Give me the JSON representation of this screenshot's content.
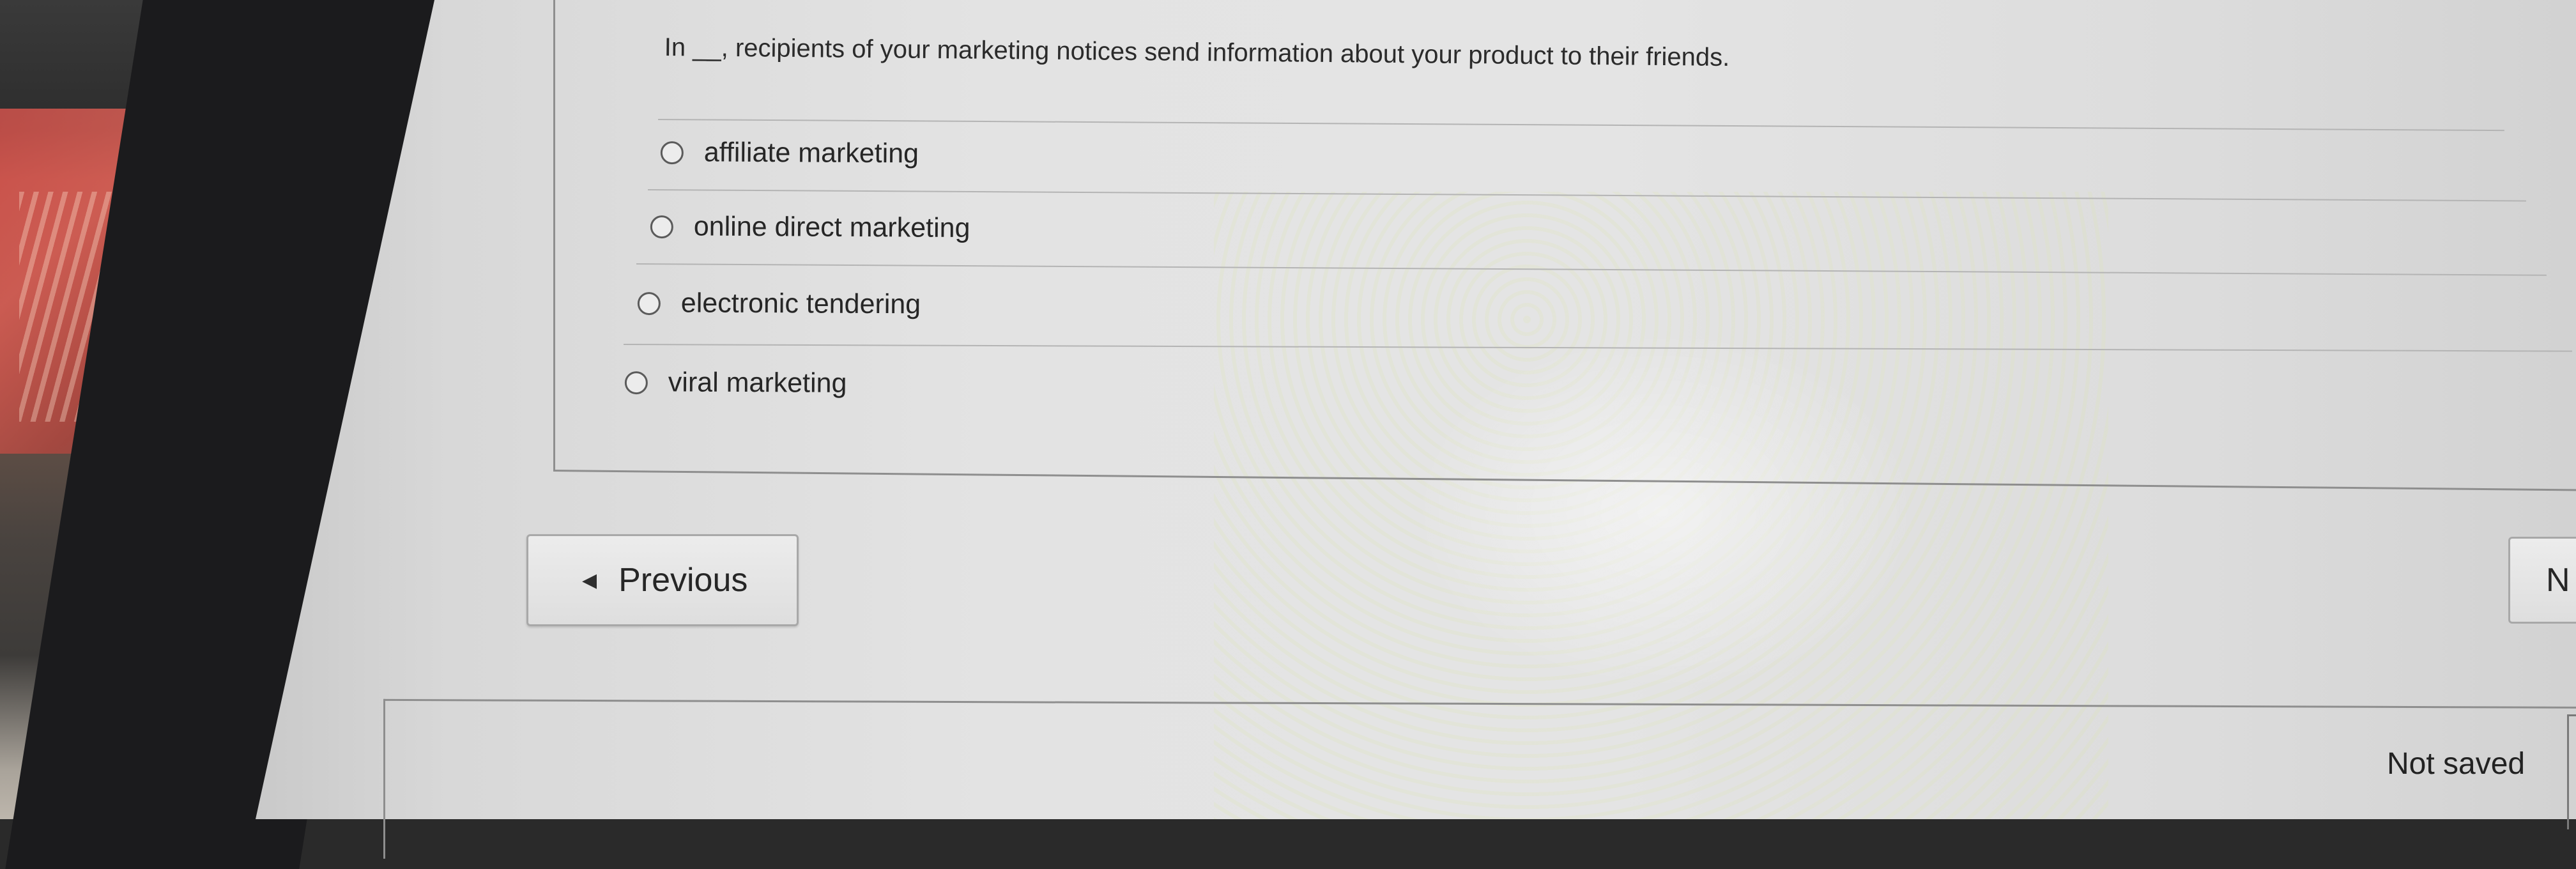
{
  "question": {
    "text": "In __, recipients of your marketing notices send information about your product to their friends."
  },
  "options": [
    {
      "label": "affiliate marketing",
      "selected": false
    },
    {
      "label": "online direct marketing",
      "selected": false
    },
    {
      "label": "electronic tendering",
      "selected": false
    },
    {
      "label": "viral marketing",
      "selected": false
    }
  ],
  "navigation": {
    "previous_label": "Previous",
    "previous_icon": "caret-left-icon",
    "next_label": "N"
  },
  "status": {
    "save_state": "Not saved"
  },
  "colors": {
    "page_background": "#e3e3e3",
    "text": "#262626",
    "border": "#8e8e8e"
  }
}
